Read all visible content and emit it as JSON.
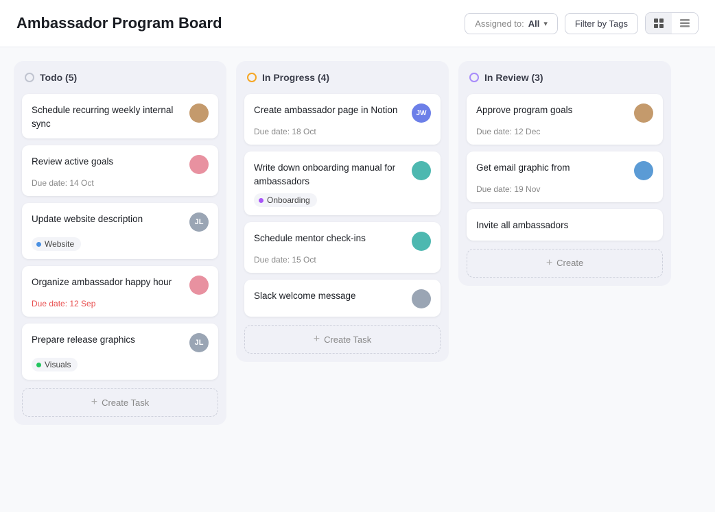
{
  "header": {
    "title": "Ambassador Program Board",
    "assigned_label": "Assigned to:",
    "assigned_value": "All",
    "filter_label": "Filter by Tags",
    "view_grid_icon": "grid-view-icon",
    "view_list_icon": "list-view-icon"
  },
  "columns": [
    {
      "id": "todo",
      "dot_class": "todo",
      "title": "Todo (5)",
      "cards": [
        {
          "id": "card-1",
          "title": "Schedule recurring weekly internal sync",
          "due": null,
          "tags": [],
          "avatar_class": "av-brown",
          "avatar_initials": ""
        },
        {
          "id": "card-2",
          "title": "Review active goals",
          "due": "Due date: 14 Oct",
          "due_class": "",
          "tags": [],
          "avatar_class": "av-pink",
          "avatar_initials": ""
        },
        {
          "id": "card-3",
          "title": "Update website description",
          "due": null,
          "due_class": "",
          "tags": [
            "Website"
          ],
          "tag_dot_class": "blue",
          "avatar_class": "av-gray",
          "avatar_initials": "JL"
        },
        {
          "id": "card-4",
          "title": "Organize ambassador happy hour",
          "due": "Due date: 12 Sep",
          "due_class": "overdue",
          "tags": [],
          "avatar_class": "av-pink",
          "avatar_initials": ""
        },
        {
          "id": "card-5",
          "title": "Prepare release graphics",
          "due": null,
          "due_class": "",
          "tags": [
            "Visuals"
          ],
          "tag_dot_class": "green",
          "avatar_class": "av-gray",
          "avatar_initials": "JL"
        }
      ],
      "create_label": "Create Task"
    },
    {
      "id": "inprogress",
      "dot_class": "inprogress",
      "title": "In Progress (4)",
      "cards": [
        {
          "id": "card-6",
          "title": "Create ambassador page in Notion",
          "due": "Due date: 18 Oct",
          "due_class": "",
          "tags": [],
          "avatar_class": "av-jw",
          "avatar_initials": "JW"
        },
        {
          "id": "card-7",
          "title": "Write down onboarding manual for ambassadors",
          "due": null,
          "due_class": "",
          "tags": [
            "Onboarding"
          ],
          "tag_dot_class": "purple",
          "avatar_class": "av-teal",
          "avatar_initials": ""
        },
        {
          "id": "card-8",
          "title": "Schedule mentor check-ins",
          "due": "Due date: 15 Oct",
          "due_class": "",
          "tags": [],
          "avatar_class": "av-teal",
          "avatar_initials": ""
        },
        {
          "id": "card-9",
          "title": "Slack welcome message",
          "due": null,
          "due_class": "",
          "tags": [],
          "avatar_class": "av-gray",
          "avatar_initials": ""
        }
      ],
      "create_label": "Create Task"
    },
    {
      "id": "inreview",
      "dot_class": "inreview",
      "title": "In Review (3)",
      "cards": [
        {
          "id": "card-10",
          "title": "Approve program goals",
          "due": "Due date: 12 Dec",
          "due_class": "",
          "tags": [],
          "avatar_class": "av-brown",
          "avatar_initials": ""
        },
        {
          "id": "card-11",
          "title": "Get email graphic from",
          "due": "Due date: 19 Nov",
          "due_class": "",
          "tags": [],
          "avatar_class": "av-blue",
          "avatar_initials": ""
        },
        {
          "id": "card-12",
          "title": "Invite all ambassadors",
          "due": null,
          "due_class": "",
          "tags": [],
          "avatar_class": null,
          "avatar_initials": ""
        }
      ],
      "create_label": "Create"
    }
  ]
}
